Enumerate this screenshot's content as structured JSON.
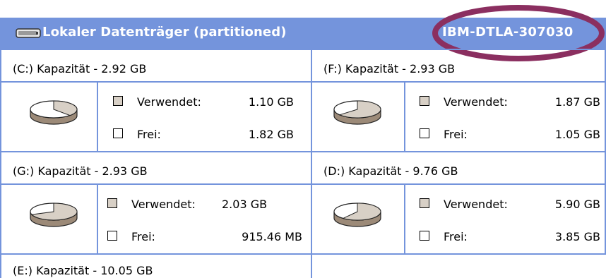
{
  "header": {
    "title": "Lokaler Datenträger  (partitioned)",
    "model": "IBM-DTLA-307030"
  },
  "colors": {
    "header_bg": "#7494dc",
    "used_swatch": "#d8d0c6",
    "free_swatch": "#ffffff",
    "annotation_ring": "#8b2f60"
  },
  "partitions": [
    {
      "title": "(C:) Kapazität - 2.92 GB",
      "used_label": "Verwendet:",
      "used_value": "1.10 GB",
      "free_label": "Frei:",
      "free_value": "1.82 GB",
      "used_fraction": 0.377
    },
    {
      "title": "(F:) Kapazität - 2.93 GB",
      "used_label": "Verwendet:",
      "used_value": "1.87 GB",
      "free_label": "Frei:",
      "free_value": "1.05 GB",
      "used_fraction": 0.638
    },
    {
      "title": "(G:) Kapazität - 2.93 GB",
      "used_label": "Verwendet:",
      "used_value": "2.03 GB",
      "free_label": "Frei:",
      "free_value": "915.46 MB",
      "used_fraction": 0.694
    },
    {
      "title": "(D:) Kapazität - 9.76 GB",
      "used_label": "Verwendet:",
      "used_value": "5.90 GB",
      "free_label": "Frei:",
      "free_value": "3.85 GB",
      "used_fraction": 0.605
    },
    {
      "title": "(E:) Kapazität - 10.05 GB"
    }
  ],
  "icons": {
    "drive": "hard-drive-icon",
    "pie": "disk-usage-pie-icon",
    "swatch": "legend-swatch-icon"
  }
}
